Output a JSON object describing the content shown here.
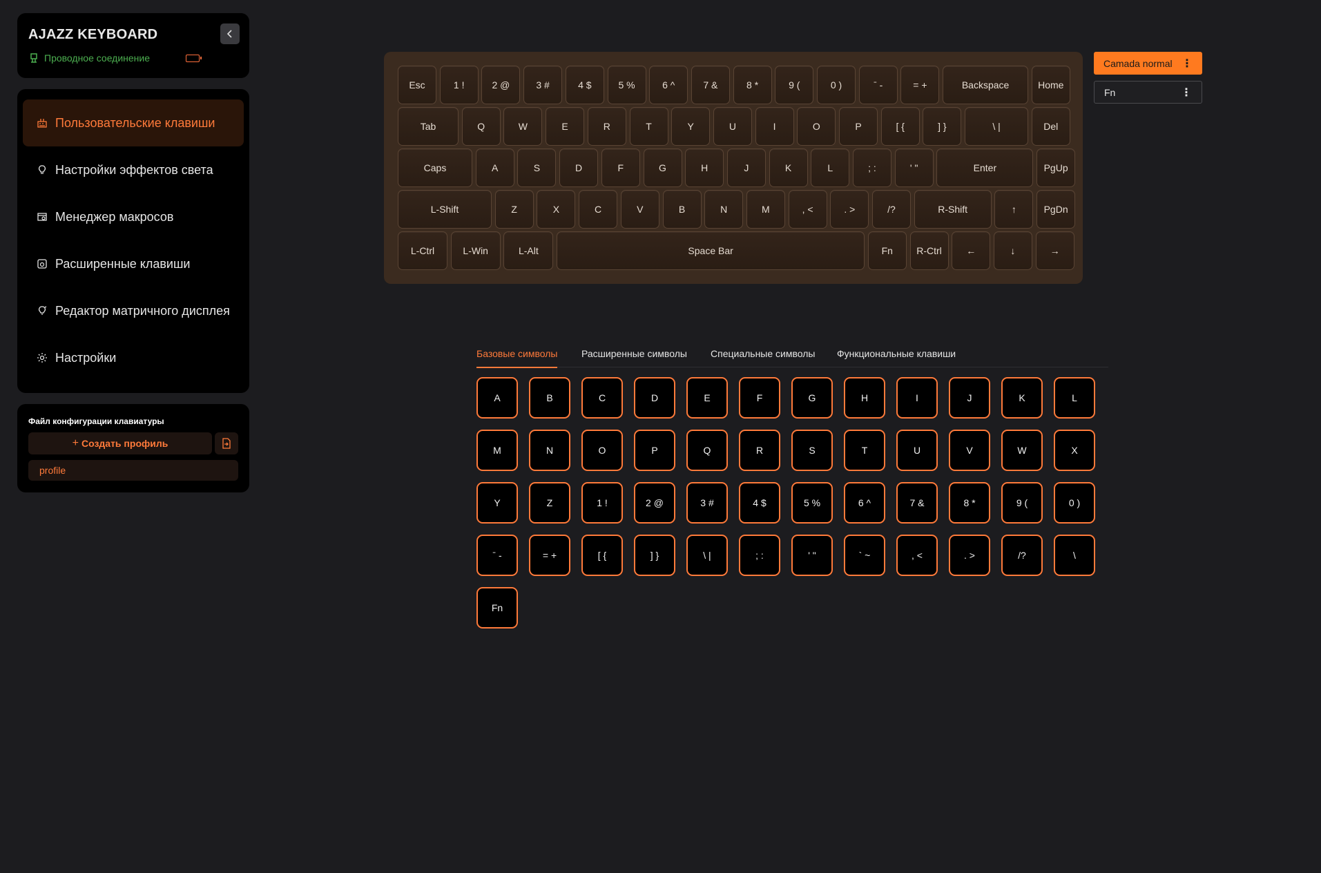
{
  "app": {
    "title": "AJAZZ KEYBOARD",
    "connection": "Проводное соединение"
  },
  "colors": {
    "accent": "#ff7a3a",
    "connection": "#4caf50",
    "keyboard_bg": "#3b2b1f"
  },
  "sidebar": {
    "items": [
      {
        "label": "Пользовательские клавиши",
        "icon": "keys-icon",
        "active": true
      },
      {
        "label": "Настройки эффектов света",
        "icon": "bulb-icon",
        "active": false
      },
      {
        "label": "Менеджер макросов",
        "icon": "macro-icon",
        "active": false
      },
      {
        "label": "Расширенные клавиши",
        "icon": "advanced-key-icon",
        "active": false
      },
      {
        "label": "Редактор матричного дисплея",
        "icon": "matrix-display-icon",
        "active": false
      },
      {
        "label": "Настройки",
        "icon": "gear-icon",
        "active": false
      }
    ]
  },
  "profiles": {
    "title": "Файл конфигурации клавиатуры",
    "create_label": "Создать профиль",
    "items": [
      "profile"
    ]
  },
  "keyboard": {
    "rows": [
      [
        "Esc",
        "1 !",
        "2 @",
        "3 #",
        "4 $",
        "5 %",
        "6 ^",
        "7 &",
        "8 *",
        "9 (",
        "0 )",
        "ˉ -",
        "= +",
        "Backspace",
        "Home"
      ],
      [
        "Tab",
        "Q",
        "W",
        "E",
        "R",
        "T",
        "Y",
        "U",
        "I",
        "O",
        "P",
        "[ {",
        "] }",
        "\\ |",
        "Del"
      ],
      [
        "Caps",
        "A",
        "S",
        "D",
        "F",
        "G",
        "H",
        "J",
        "K",
        "L",
        "; :",
        "' \"",
        "Enter",
        "PgUp"
      ],
      [
        "L-Shift",
        "Z",
        "X",
        "C",
        "V",
        "B",
        "N",
        "M",
        ", <",
        ". >",
        "/?",
        "R-Shift",
        "↑",
        "PgDn"
      ],
      [
        "L-Ctrl",
        "L-Win",
        "L-Alt",
        "Space Bar",
        "Fn",
        "R-Ctrl",
        "←",
        "↓",
        "→"
      ]
    ]
  },
  "layers": {
    "active": "Camada normal",
    "second": "Fn",
    "more": "⋮"
  },
  "tabs": [
    "Базовые символы",
    "Расширенные символы",
    "Специальные символы",
    "Функциональные клавиши"
  ],
  "palette": [
    "A",
    "B",
    "C",
    "D",
    "E",
    "F",
    "G",
    "H",
    "I",
    "J",
    "K",
    "L",
    "M",
    "N",
    "O",
    "P",
    "Q",
    "R",
    "S",
    "T",
    "U",
    "V",
    "W",
    "X",
    "Y",
    "Z",
    "1 !",
    "2 @",
    "3 #",
    "4 $",
    "5 %",
    "6 ^",
    "7 &",
    "8 *",
    "9 (",
    "0 )",
    "ˉ -",
    "= +",
    "[ {",
    "] }",
    "\\ |",
    "; :",
    "' \"",
    "` ~",
    ", <",
    ". >",
    "/?",
    "\\",
    "Fn"
  ]
}
